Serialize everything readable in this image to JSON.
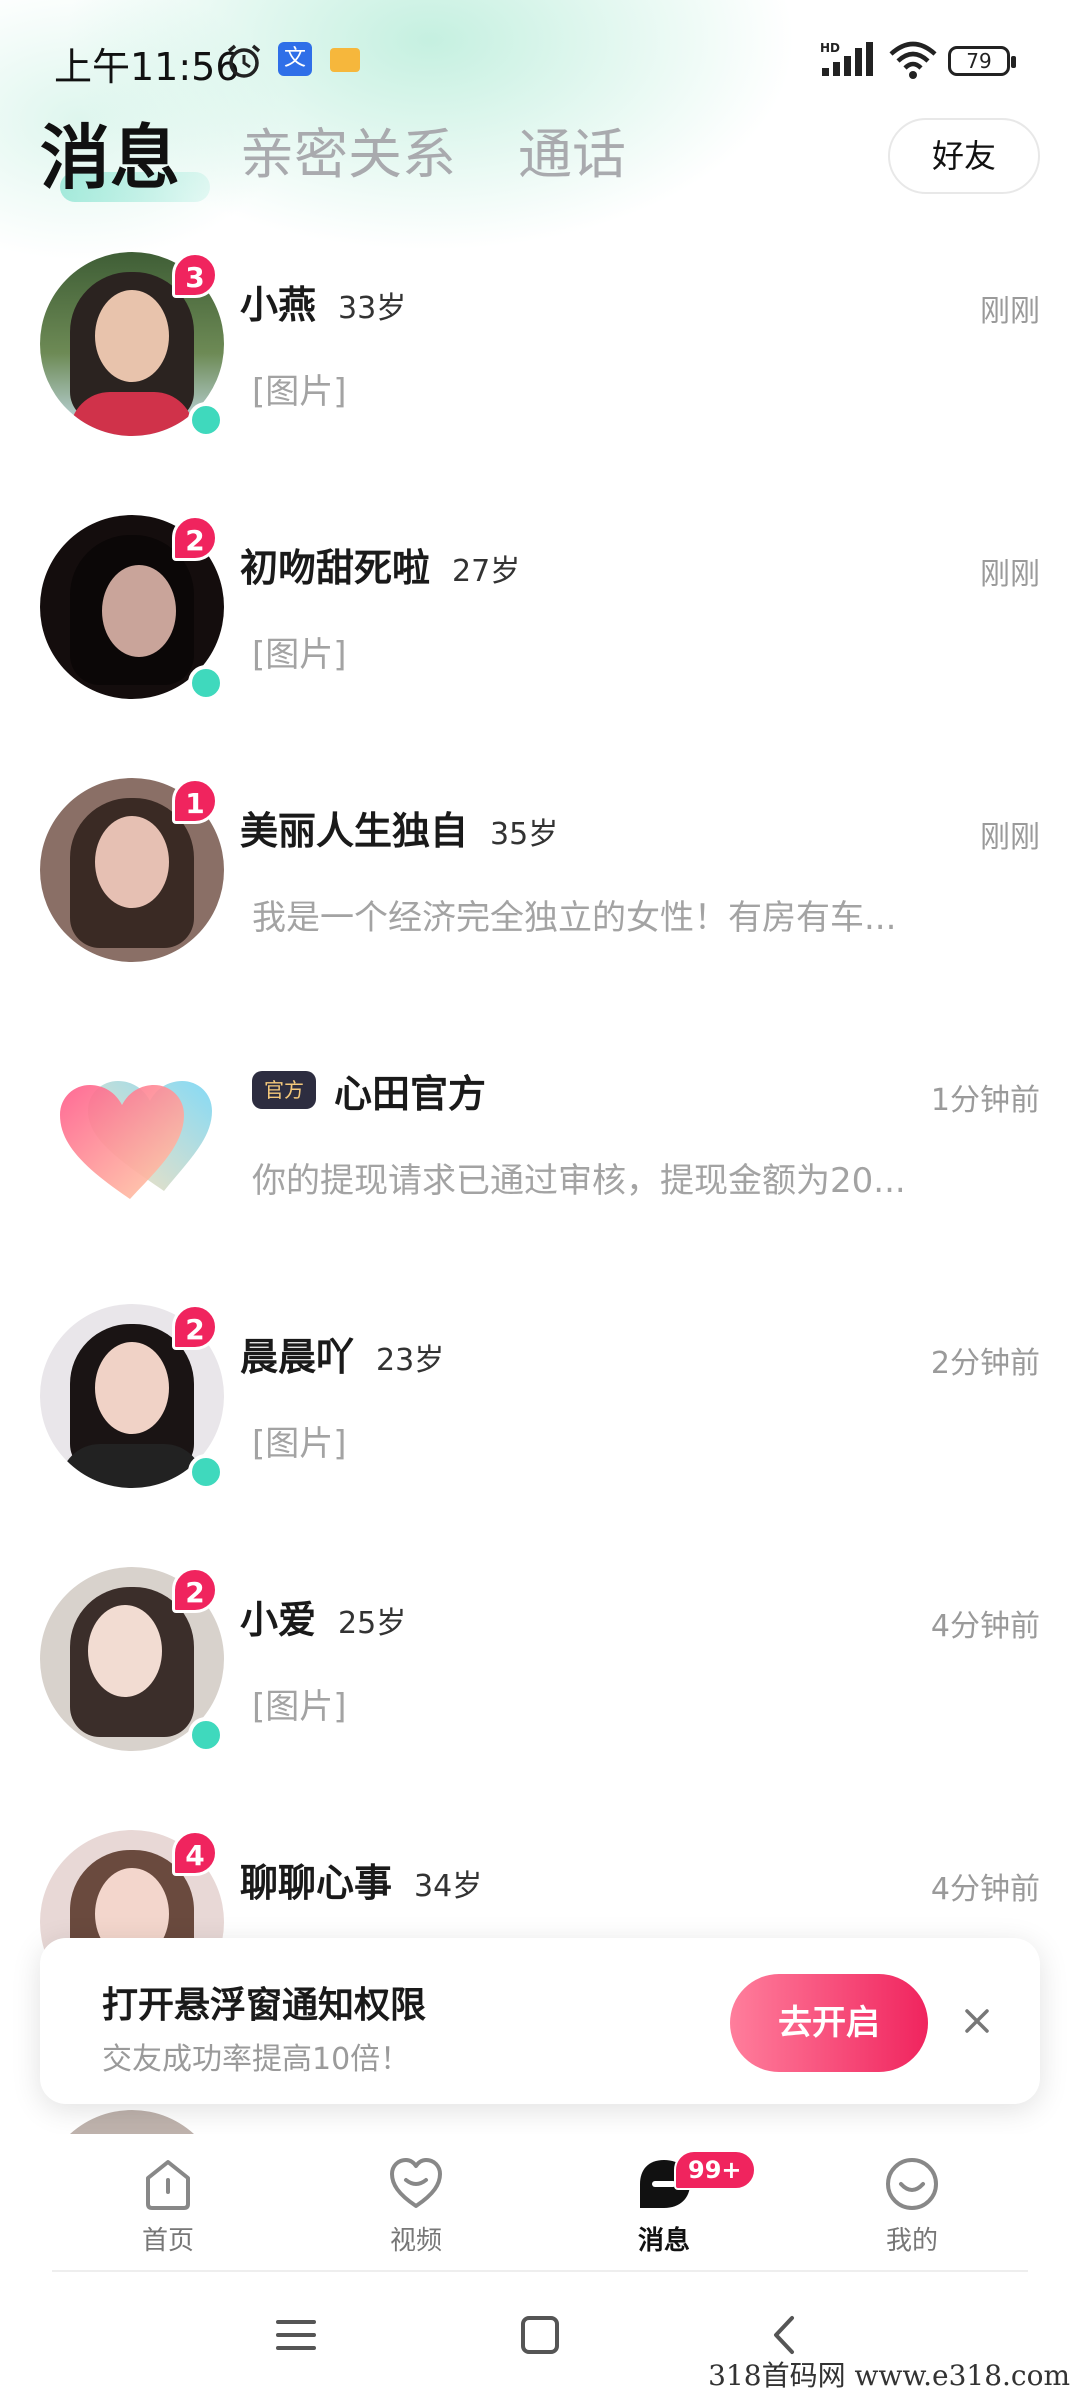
{
  "status_bar": {
    "time": "上午11:56",
    "battery": "79",
    "icons": [
      "alarm-icon",
      "translate-icon",
      "note-icon",
      "hd-signal-icon",
      "wifi-icon",
      "battery-icon"
    ]
  },
  "header": {
    "tabs": [
      {
        "label": "消息",
        "active": true
      },
      {
        "label": "亲密关系",
        "active": false
      },
      {
        "label": "通话",
        "active": false
      }
    ],
    "friends_button": "好友"
  },
  "messages": [
    {
      "name": "小燕",
      "age": "33岁",
      "time": "刚刚",
      "preview": "[图片]",
      "unread": "3",
      "online": true
    },
    {
      "name": "初吻甜死啦",
      "age": "27岁",
      "time": "刚刚",
      "preview": "[图片]",
      "unread": "2",
      "online": true
    },
    {
      "name": "美丽人生独自",
      "age": "35岁",
      "time": "刚刚",
      "preview": "我是一个经济完全独立的女性！有房有车...",
      "unread": "1",
      "online": false
    },
    {
      "badge": "官方",
      "name": "心田官方",
      "time": "1分钟前",
      "preview": "你的提现请求已通过审核，提现金额为20..."
    },
    {
      "name": "晨晨吖",
      "age": "23岁",
      "time": "2分钟前",
      "preview": "[图片]",
      "unread": "2",
      "online": true
    },
    {
      "name": "小爱",
      "age": "25岁",
      "time": "4分钟前",
      "preview": "[图片]",
      "unread": "2",
      "online": true
    },
    {
      "name": "聊聊心事",
      "age": "34岁",
      "time": "4分钟前",
      "unread": "4"
    }
  ],
  "permission_banner": {
    "title": "打开悬浮窗通知权限",
    "subtitle": "交友成功率提高10倍！",
    "button": "去开启"
  },
  "bottom_nav": {
    "items": [
      {
        "label": "首页",
        "icon": "home-icon"
      },
      {
        "label": "视频",
        "icon": "heart-icon"
      },
      {
        "label": "消息",
        "icon": "message-icon",
        "badge": "99+",
        "active": true
      },
      {
        "label": "我的",
        "icon": "smile-icon"
      }
    ]
  },
  "watermark": "318首码网 www.e318.com",
  "colors": {
    "accent": "#f0245e",
    "online": "#3fd9bd",
    "muted": "#a3a3a3"
  }
}
